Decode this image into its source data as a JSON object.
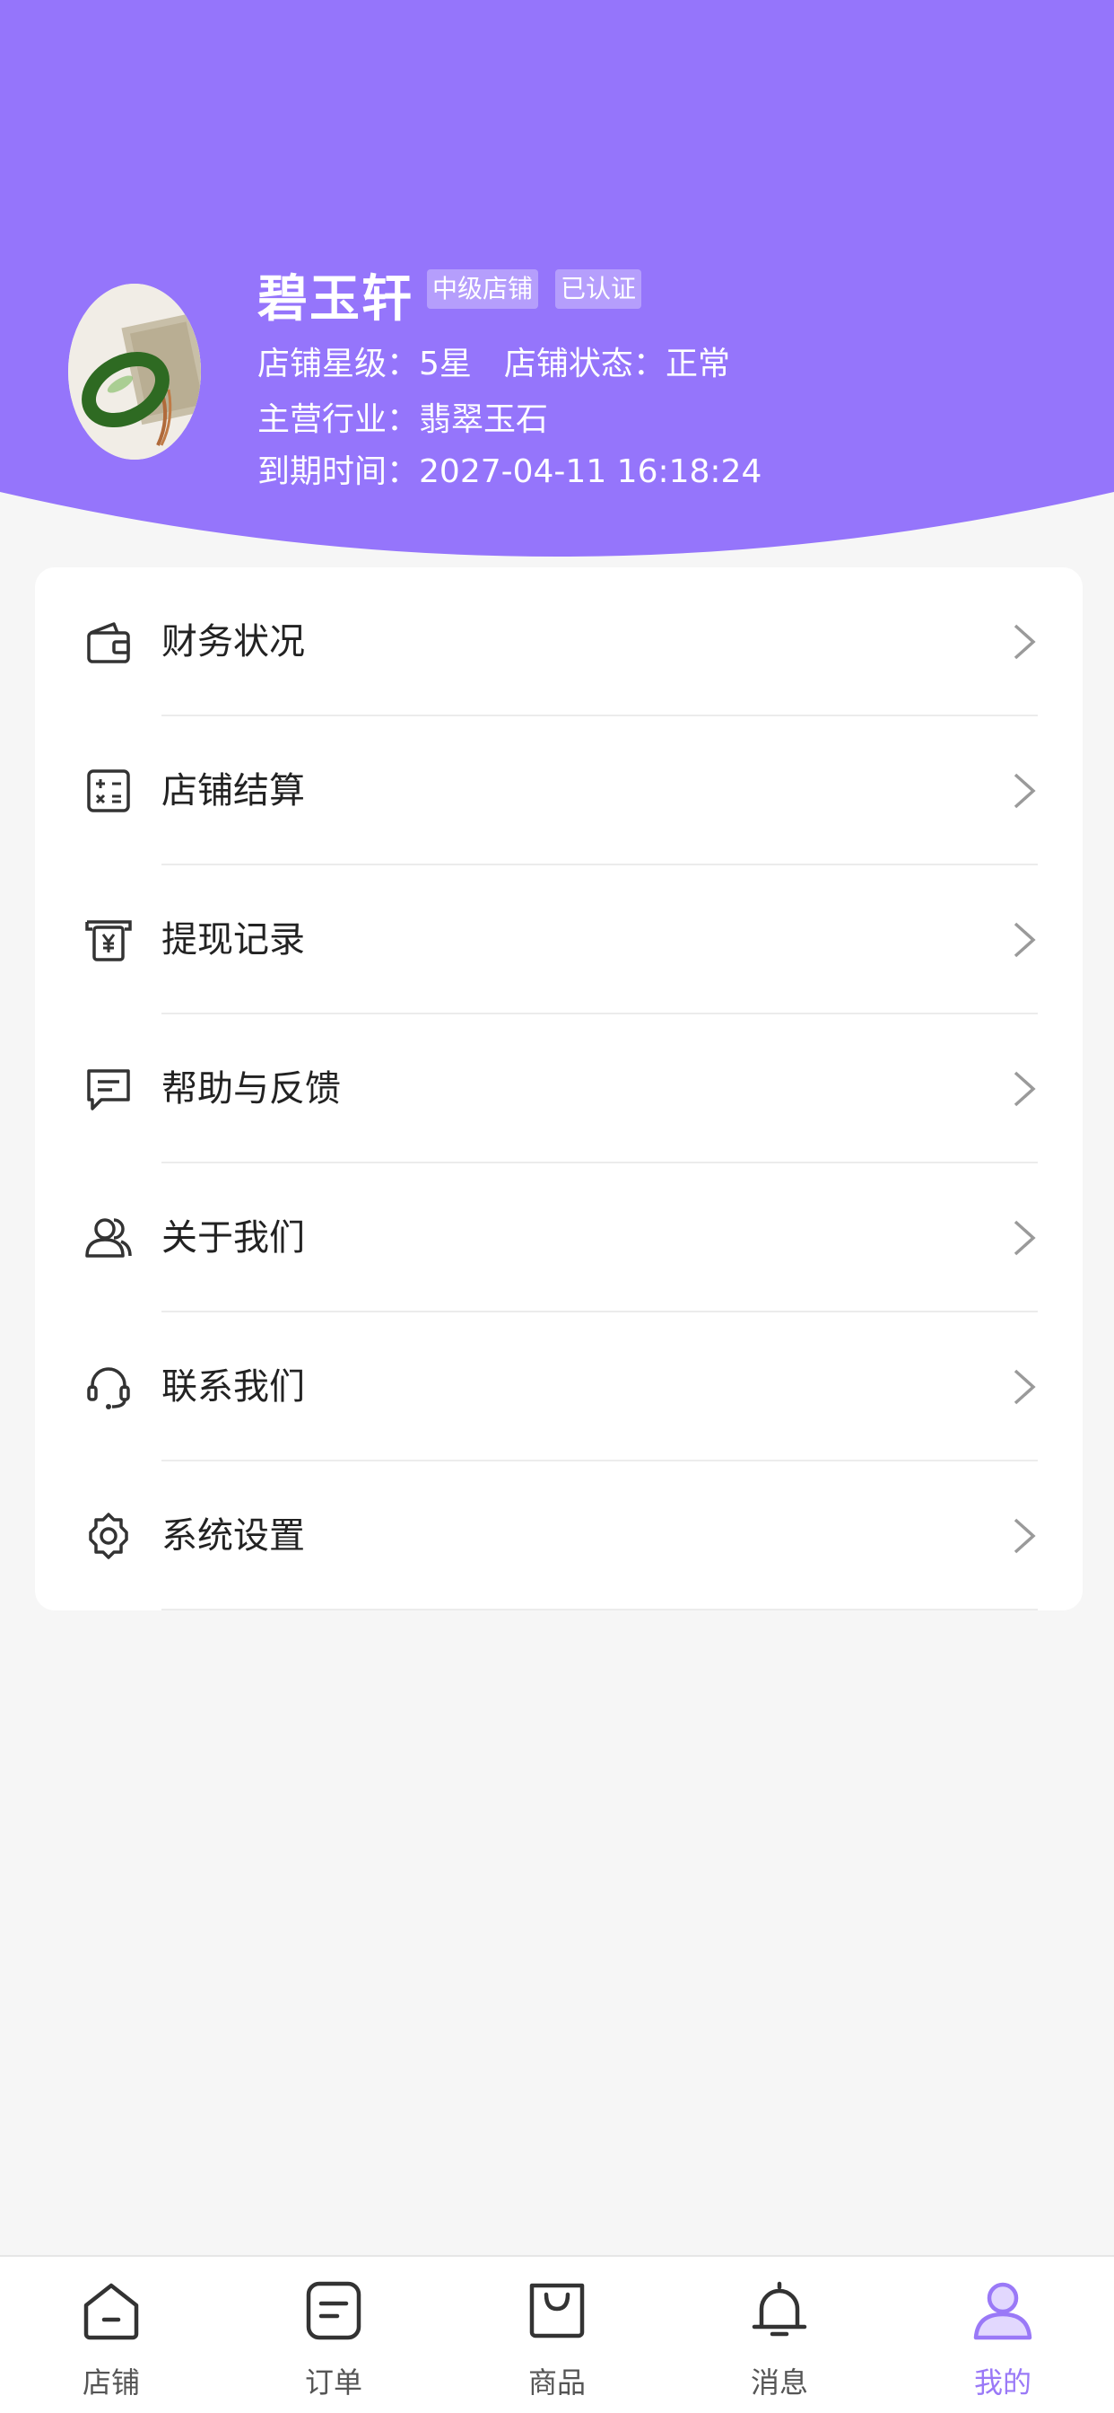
{
  "colors": {
    "accent": "#9575fb",
    "tab_active": "#9a79f7",
    "background": "#f6f6f6"
  },
  "shop": {
    "name": "碧玉轩",
    "badges": [
      "中级店铺",
      "已认证"
    ],
    "star_label": "店铺星级：",
    "star_value": "5星",
    "status_label": "店铺状态：",
    "status_value": "正常",
    "industry_label": "主营行业：",
    "industry_value": "翡翠玉石",
    "expiry_label": "到期时间：",
    "expiry_value": "2027-04-11 16:18:24"
  },
  "menu": [
    {
      "label": "财务状况",
      "icon": "wallet-icon"
    },
    {
      "label": "店铺结算",
      "icon": "calculator-icon"
    },
    {
      "label": "提现记录",
      "icon": "withdraw-icon"
    },
    {
      "label": "帮助与反馈",
      "icon": "message-icon"
    },
    {
      "label": "关于我们",
      "icon": "users-icon"
    },
    {
      "label": "联系我们",
      "icon": "headset-icon"
    },
    {
      "label": "系统设置",
      "icon": "gear-icon"
    }
  ],
  "tabs": [
    {
      "label": "店铺",
      "icon": "home-icon",
      "active": false
    },
    {
      "label": "订单",
      "icon": "order-icon",
      "active": false
    },
    {
      "label": "商品",
      "icon": "bag-icon",
      "active": false
    },
    {
      "label": "消息",
      "icon": "bell-icon",
      "active": false
    },
    {
      "label": "我的",
      "icon": "user-icon",
      "active": true
    }
  ]
}
